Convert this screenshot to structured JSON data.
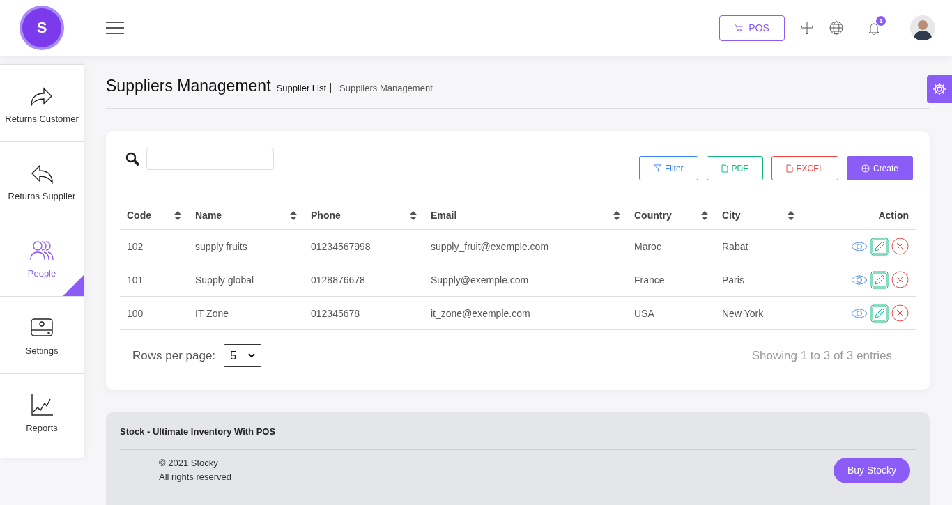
{
  "logo": {
    "letter": "S"
  },
  "header": {
    "pos_button": "POS",
    "notification_count": "1"
  },
  "sidebar": {
    "items": [
      {
        "label": "Returns Customer",
        "selected": false
      },
      {
        "label": "Returns Supplier",
        "selected": false
      },
      {
        "label": "People",
        "selected": true
      },
      {
        "label": "Settings",
        "selected": false
      },
      {
        "label": "Reports",
        "selected": false
      }
    ]
  },
  "page": {
    "title": "Suppliers Management",
    "breadcrumb": [
      "Supplier List",
      "Suppliers Management"
    ]
  },
  "toolbar": {
    "buttons": [
      {
        "label": "Filter",
        "kind": "filter"
      },
      {
        "label": "PDF",
        "kind": "pdf"
      },
      {
        "label": "EXCEL",
        "kind": "excel"
      },
      {
        "label": "Create",
        "kind": "create"
      }
    ]
  },
  "table": {
    "columns": [
      {
        "label": "Code",
        "sortable": true
      },
      {
        "label": "Name",
        "sortable": true
      },
      {
        "label": "Phone",
        "sortable": true
      },
      {
        "label": "Email",
        "sortable": true
      },
      {
        "label": "Country",
        "sortable": true
      },
      {
        "label": "City",
        "sortable": true
      },
      {
        "label": "Action",
        "sortable": false
      }
    ],
    "rows": [
      [
        "102",
        "supply fruits",
        "01234567998",
        "supply_fruit@exemple.com",
        "Maroc",
        "Rabat"
      ],
      [
        "101",
        "Supply global",
        "0128876678",
        "Supply@exemple.com",
        "France",
        "Paris"
      ],
      [
        "100",
        "IT Zone",
        "012345678",
        "it_zone@exemple.com",
        "USA",
        "New York"
      ]
    ]
  },
  "pagination": {
    "rows_per_page_label": "Rows per page:",
    "rows_per_page": "5",
    "summary": "Showing 1 to 3 of 3 entries"
  },
  "footer": {
    "title": "Stock - Ultimate Inventory With POS",
    "copyright": "© 2021 Stocky",
    "rights": "All rights reserved",
    "button": "Buy Stocky"
  }
}
